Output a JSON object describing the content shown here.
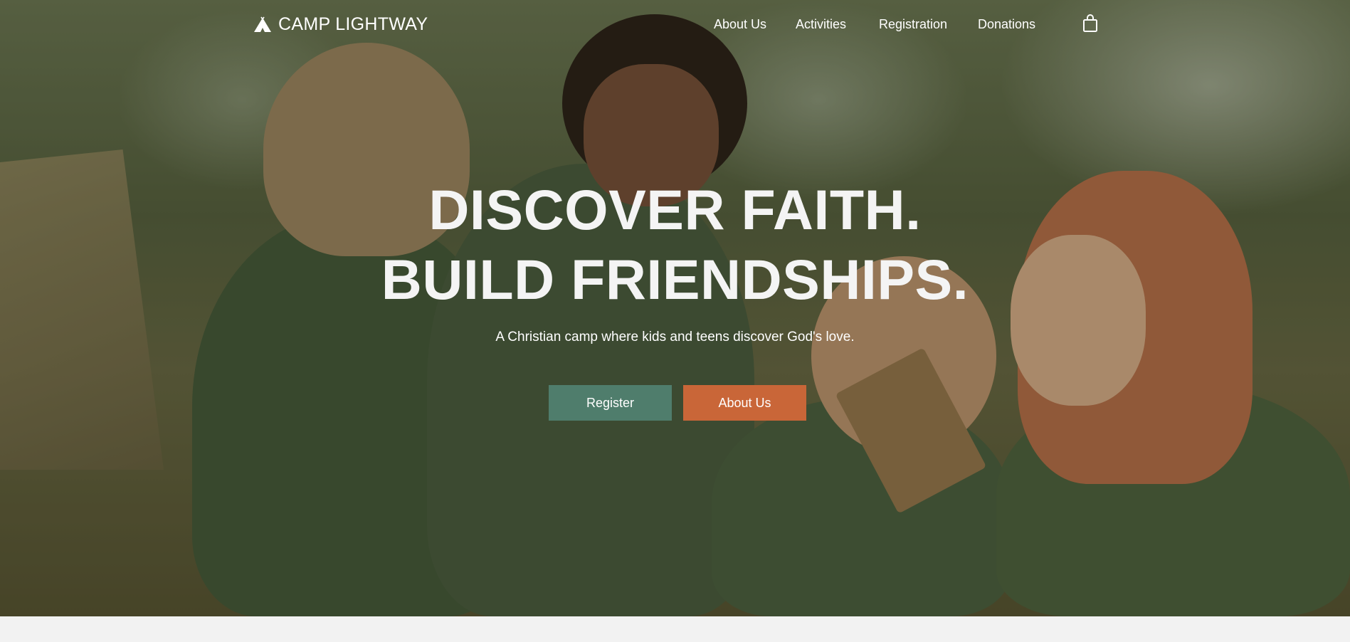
{
  "brand": {
    "name": "CAMP LIGHTWAY",
    "icon": "tent-icon"
  },
  "nav": {
    "items": [
      {
        "label": "About Us"
      },
      {
        "label": "Activities"
      },
      {
        "label": "Registration"
      },
      {
        "label": "Donations"
      }
    ],
    "cart_icon": "shopping-bag-icon"
  },
  "hero": {
    "headline_line1": "DISCOVER FAITH.",
    "headline_line2": "BUILD FRIENDSHIPS.",
    "subtitle": "A Christian camp where kids and teens discover God's love.",
    "register_label": "Register",
    "about_label": "About Us"
  },
  "colors": {
    "register_button": "#4f7d6c",
    "about_button": "#c96638",
    "text": "#ffffff",
    "page_background": "#f2f2f2"
  }
}
